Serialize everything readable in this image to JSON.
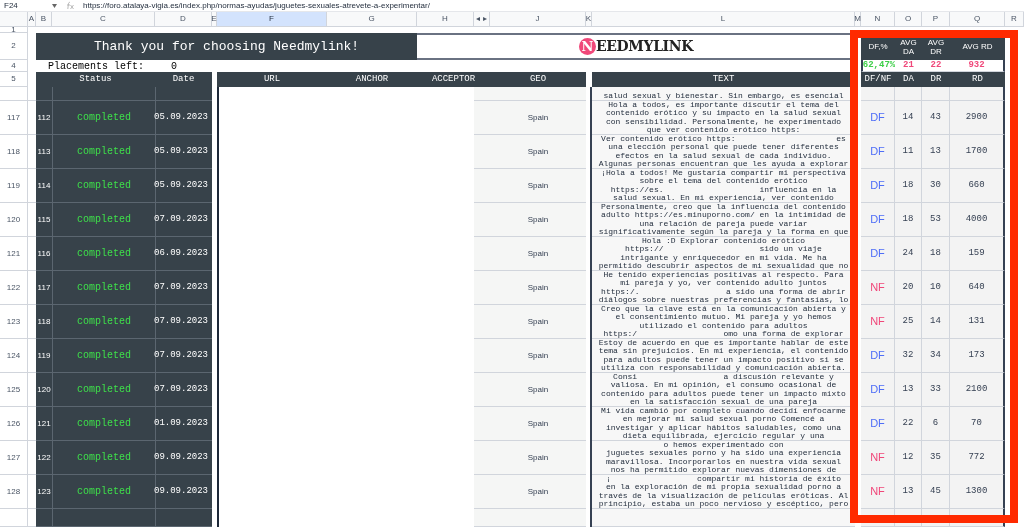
{
  "formula_bar": {
    "cell_ref": "F24",
    "formula": "https://foro.atalaya-vigia.es/index.php/normas-ayudas/juguetes-sexuales-atrevete-a-experimentar/"
  },
  "columns": [
    {
      "label": "A",
      "selected": false
    },
    {
      "label": "B",
      "selected": false
    },
    {
      "label": "C",
      "selected": false
    },
    {
      "label": "D",
      "selected": false
    },
    {
      "label": "E",
      "selected": false
    },
    {
      "label": "F",
      "selected": true
    },
    {
      "label": "G",
      "selected": false
    },
    {
      "label": "H",
      "selected": false
    },
    {
      "label": "◂ ▸",
      "selected": false
    },
    {
      "label": "J",
      "selected": false
    },
    {
      "label": "K",
      "selected": false
    },
    {
      "label": "L",
      "selected": false
    },
    {
      "label": "M",
      "selected": false
    },
    {
      "label": "N",
      "selected": false
    },
    {
      "label": "O",
      "selected": false
    },
    {
      "label": "P",
      "selected": false
    },
    {
      "label": "Q",
      "selected": false
    },
    {
      "label": "R",
      "selected": false
    }
  ],
  "header_rows": [
    "1",
    "2",
    "4",
    "5"
  ],
  "banner": {
    "title": "Thank you for choosing Needmylink!",
    "logo_letter": "N",
    "logo_rest": "EEDMYLINK"
  },
  "placements": {
    "label": "Placements left:",
    "value": "0"
  },
  "summary": [
    {
      "label": "DF,%",
      "value": "62,47%",
      "color": "#3fcf4a"
    },
    {
      "label": "AVG DA",
      "value": "21",
      "color": "#f0487a"
    },
    {
      "label": "AVG DR",
      "value": "22",
      "color": "#f0487a"
    },
    {
      "label": "AVG RD",
      "value": "932",
      "color": "#f0487a"
    }
  ],
  "headers": {
    "status": "Status",
    "date": "Date",
    "url": "URL",
    "anchor": "ANCHOR",
    "acceptor": "ACCEPTOR",
    "geo": "GEO",
    "text": "TEXT",
    "link": "DF/NF",
    "da": "DA",
    "dr": "DR",
    "rd": "RD"
  },
  "partial_text": "salud sexual y bienestar. Sin embargo, es esencial",
  "rows": [
    {
      "row": "117",
      "index": "112",
      "status": "completed",
      "date": "05.09.2023",
      "geo": "Spain",
      "text": [
        "Hola a todos, es importante discutir el tema del",
        "contenido erótico y su impacto en la salud sexual",
        "con sensibilidad. Personalmente, he experimentado",
        "que ver contenido erótico https:"
      ],
      "link": "DF",
      "follow": true,
      "da": "14",
      "dr": "43",
      "rd": "2900"
    },
    {
      "row": "118",
      "index": "113",
      "status": "completed",
      "date": "05.09.2023",
      "geo": "Spain",
      "text": [
        "Ver contenido erótico https:                     es",
        "una elección personal que puede tener diferentes",
        "efectos en la salud sexual de cada individuo.",
        "Algunas personas encuentran que les ayuda a explorar"
      ],
      "link": "DF",
      "follow": true,
      "da": "11",
      "dr": "13",
      "rd": "1700"
    },
    {
      "row": "119",
      "index": "114",
      "status": "completed",
      "date": "05.09.2023",
      "geo": "Spain",
      "text": [
        "¡Hola a todos! Me gustaría compartir mi perspectiva",
        "sobre el tema del contenido erótico",
        "https://es.                    influencia en la",
        "salud sexual. En mi experiencia, ver contenido"
      ],
      "link": "DF",
      "follow": true,
      "da": "18",
      "dr": "30",
      "rd": "660"
    },
    {
      "row": "120",
      "index": "115",
      "status": "completed",
      "date": "07.09.2023",
      "geo": "Spain",
      "text": [
        "Personalmente, creo que la influencia del contenido",
        "adulto https://es.minuporno.com/ en la intimidad de",
        "una relación de pareja puede variar",
        "significativamente según la pareja y la forma en que"
      ],
      "link": "DF",
      "follow": true,
      "da": "18",
      "dr": "53",
      "rd": "4000"
    },
    {
      "row": "121",
      "index": "116",
      "status": "completed",
      "date": "06.09.2023",
      "geo": "Spain",
      "text": [
        "Hola :D Explorar contenido erótico",
        "https://                    sido un viaje",
        "intrigante y enriquecedor en mi vida. Me ha",
        "permitido descubrir aspectos de mi sexualidad que no"
      ],
      "link": "DF",
      "follow": true,
      "da": "24",
      "dr": "18",
      "rd": "159"
    },
    {
      "row": "122",
      "index": "117",
      "status": "completed",
      "date": "07.09.2023",
      "geo": "Spain",
      "text": [
        "He tenido experiencias positivas al respecto. Para",
        "mi pareja y yo, ver contenido adulto juntos",
        "https:/.                  a sido una forma de abrir",
        "diálogos sobre nuestras preferencias y fantasías, lo"
      ],
      "link": "NF",
      "follow": false,
      "da": "20",
      "dr": "10",
      "rd": "640"
    },
    {
      "row": "123",
      "index": "118",
      "status": "completed",
      "date": "07.09.2023",
      "geo": "Spain",
      "text": [
        "Creo que la clave está en la comunicación abierta y",
        "el consentimiento mutuo. Mi pareja y yo hemos",
        "utilizado el contenido para adultos",
        "https:/                  omo una forma de explorar"
      ],
      "link": "NF",
      "follow": false,
      "da": "25",
      "dr": "14",
      "rd": "131"
    },
    {
      "row": "124",
      "index": "119",
      "status": "completed",
      "date": "07.09.2023",
      "geo": "Spain",
      "text": [
        "Estoy de acuerdo en que es importante hablar de este",
        "tema sin prejuicios. En mi experiencia, el contenido",
        "para adultos puede tener un impacto positivo si se",
        "utiliza con responsabilidad y comunicación abierta."
      ],
      "link": "DF",
      "follow": true,
      "da": "32",
      "dr": "34",
      "rd": "173"
    },
    {
      "row": "125",
      "index": "120",
      "status": "completed",
      "date": "07.09.2023",
      "geo": "Spain",
      "text": [
        "Consi                  a discusión relevante y",
        "valiosa. En mi opinión, el consumo ocasional de",
        "contenido para adultos puede tener un impacto mixto",
        "en la satisfacción sexual de una pareja"
      ],
      "link": "DF",
      "follow": true,
      "da": "13",
      "dr": "33",
      "rd": "2100"
    },
    {
      "row": "126",
      "index": "121",
      "status": "completed",
      "date": "01.09.2023",
      "geo": "Spain",
      "text": [
        "Mi vida cambió por completo cuando decidí enfocarme",
        "en mejorar mi salud sexual porno Comencé a",
        "investigar y aplicar hábitos saludables, como una",
        "dieta equilibrada, ejercicio regular y una"
      ],
      "link": "DF",
      "follow": true,
      "da": "22",
      "dr": "6",
      "rd": "70"
    },
    {
      "row": "127",
      "index": "122",
      "status": "completed",
      "date": "09.09.2023",
      "geo": "Spain",
      "text": [
        "o hemos experimentado con",
        "juguetes sexuales porno y ha sido una experiencia",
        "maravillosa. Incorporarlos en nuestra vida sexual",
        "nos ha permitido explorar nuevas dimensiones de"
      ],
      "link": "NF",
      "follow": false,
      "da": "12",
      "dr": "35",
      "rd": "772"
    },
    {
      "row": "128",
      "index": "123",
      "status": "completed",
      "date": "09.09.2023",
      "geo": "Spain",
      "text": [
        "¡                  compartir mi historia de éxito",
        "en la exploración de mi propia sexualidad porno a",
        "través de la visualización de películas eróticas. Al",
        "principio, estaba un poco nervioso y escéptico, pero"
      ],
      "link": "NF",
      "follow": false,
      "da": "13",
      "dr": "45",
      "rd": "1300"
    }
  ]
}
